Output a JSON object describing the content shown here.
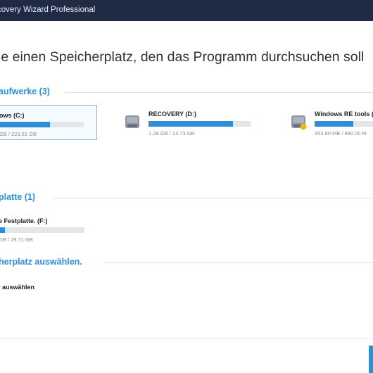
{
  "window": {
    "title": "covery Wizard Professional"
  },
  "main": {
    "heading": "ie einen Speicherplatz, den das Programm durchsuchen soll"
  },
  "sections": {
    "drives": {
      "title": "aufwerke (3)",
      "items": [
        {
          "name": "ows (C:)",
          "size": "GB / 223.51 GB",
          "usage": 0.6
        },
        {
          "name": "RECOVERY (D:)",
          "size": "1.28 GB / 13.73 GB",
          "usage": 0.83
        },
        {
          "name": "Windows RE tools (*",
          "size": "453.60 MB / 980.00 M",
          "usage": 0.46
        }
      ]
    },
    "external": {
      "title": "platte (1)",
      "items": [
        {
          "name": "e Festplatte. (F:)",
          "size": "GB / 29.71 GB",
          "usage": 0.07
        }
      ]
    },
    "location": {
      "title": "herplatz auswählen.",
      "option": "r auswählen"
    }
  },
  "icons": {
    "drive": "hard-drive-icon",
    "system_badge": "windows-badge-icon"
  },
  "colors": {
    "accent": "#2e8fd8",
    "titlebar": "#1f2a44",
    "warning_badge": "#f0b41c"
  }
}
